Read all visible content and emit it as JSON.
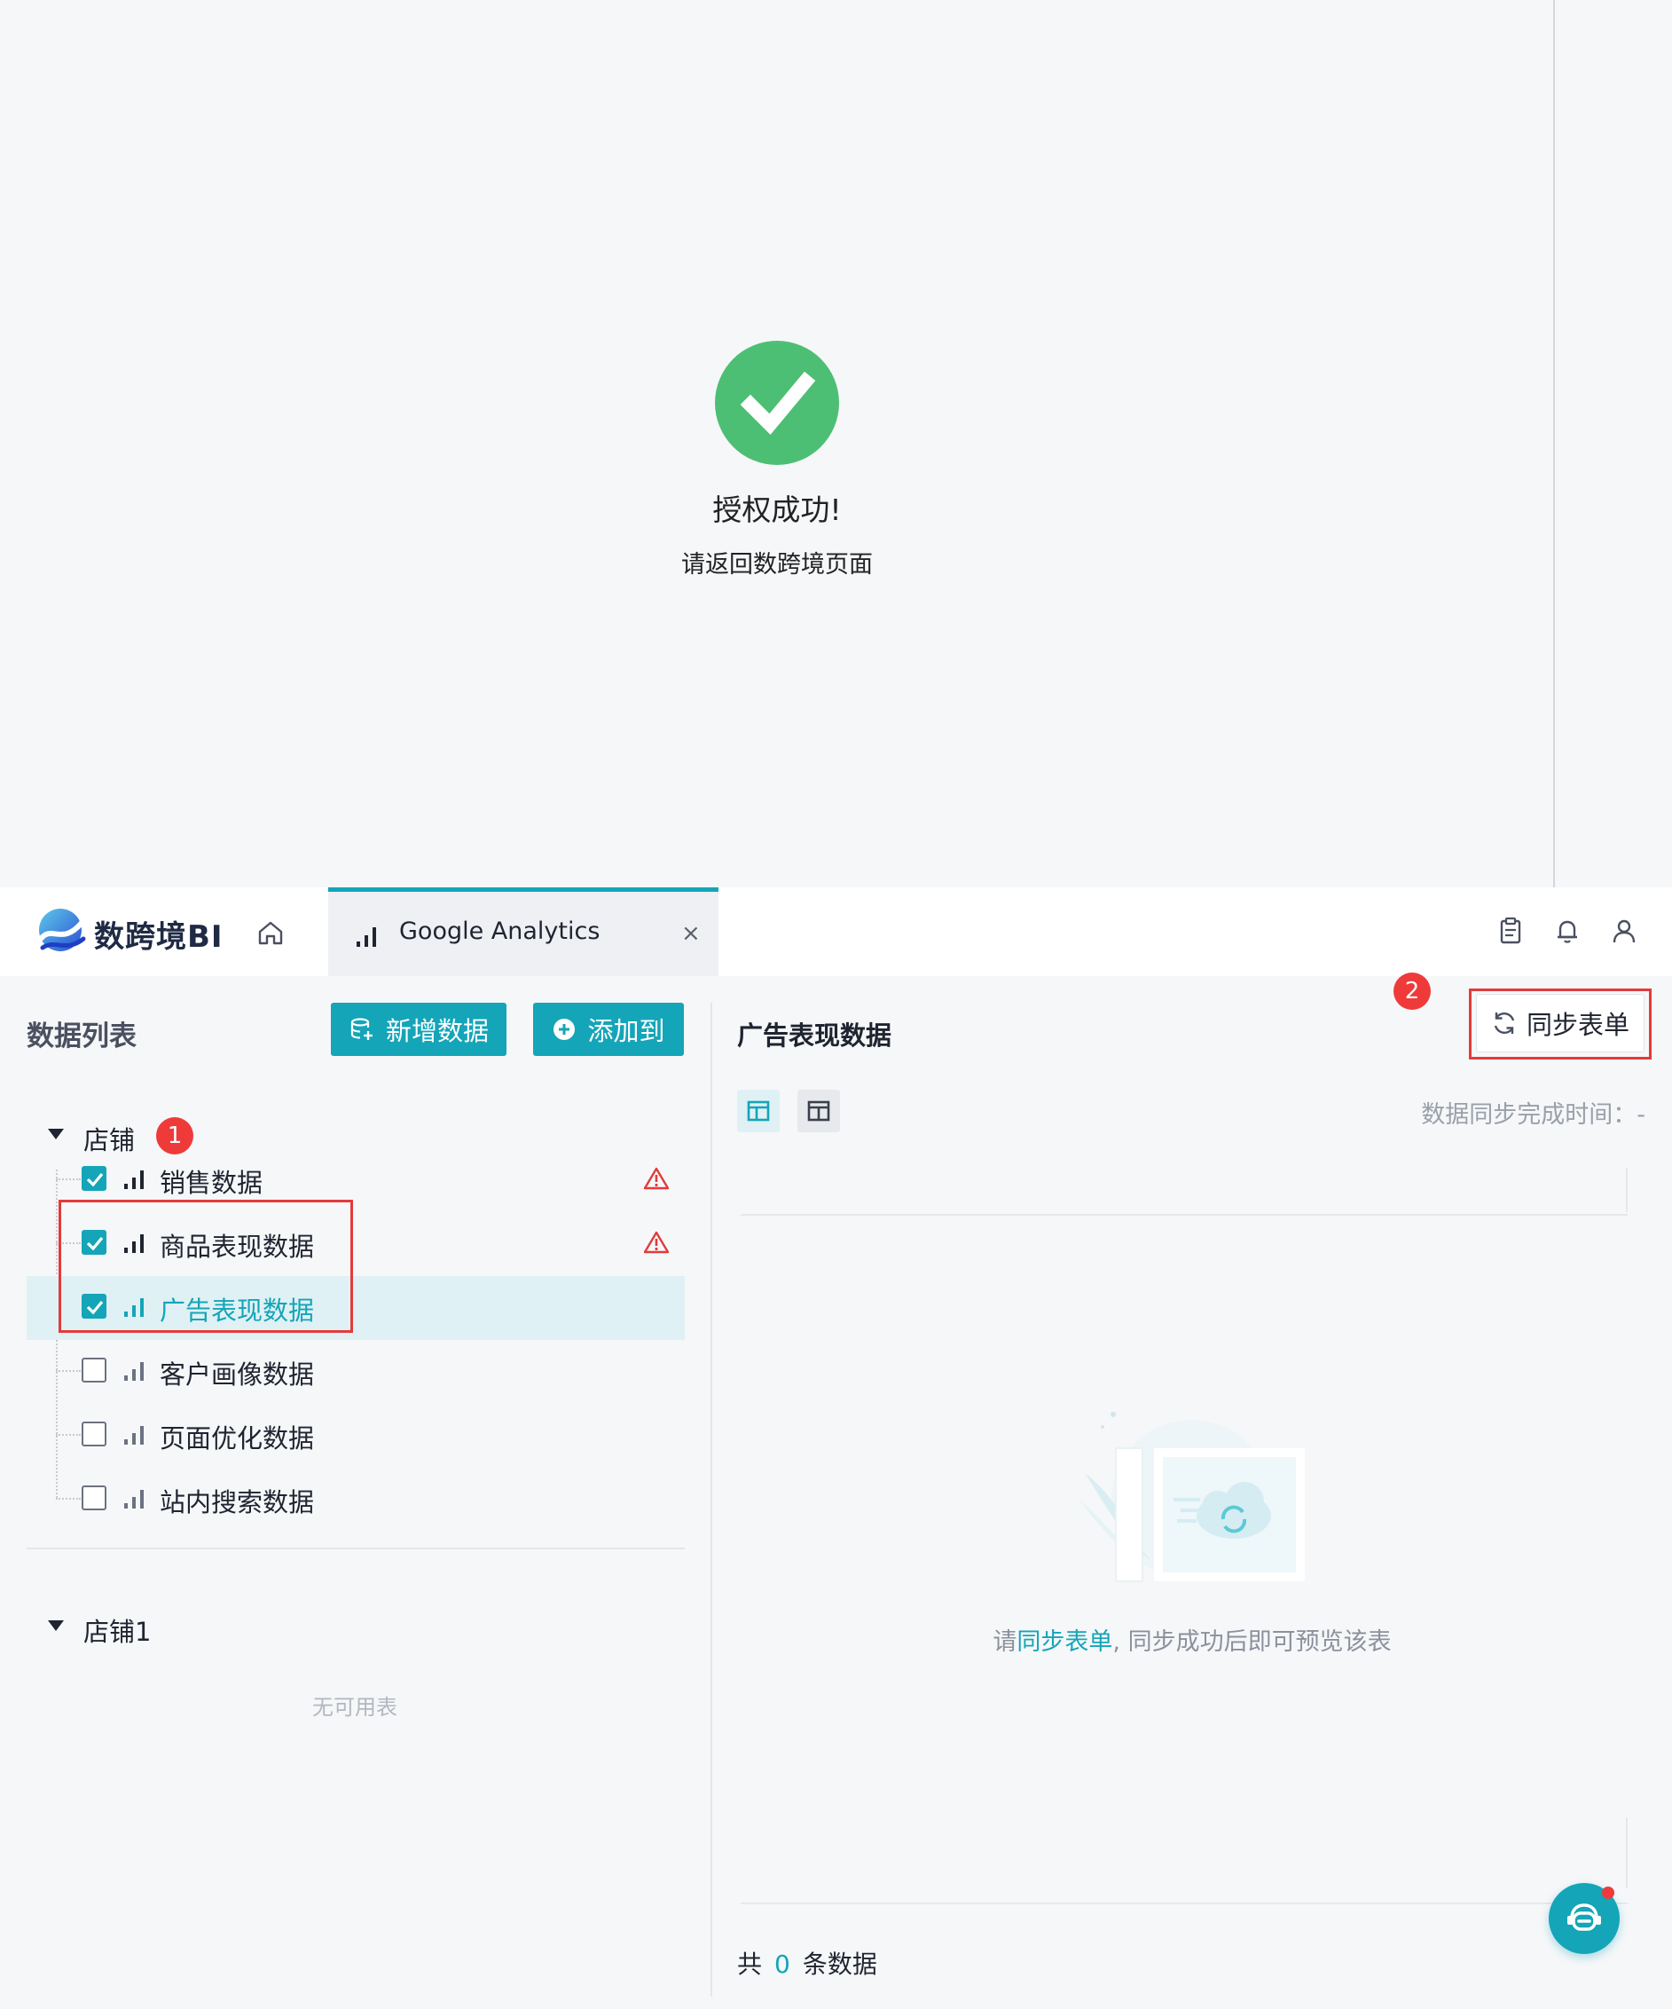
{
  "auth": {
    "title": "授权成功!",
    "subtitle": "请返回数跨境页面",
    "icon": "check-circle-icon",
    "accent": "#4dbf74"
  },
  "header": {
    "brand": "数跨境BI",
    "tab": {
      "label": "Google Analytics",
      "close": "×"
    },
    "icons": [
      "home-icon",
      "clipboard-icon",
      "bell-icon",
      "user-icon"
    ]
  },
  "left": {
    "title": "数据列表",
    "new_data_label": "新增数据",
    "add_to_label": "添加到",
    "groups": [
      {
        "label": "店铺",
        "badge": "1",
        "items": [
          {
            "label": "销售数据",
            "checked": true,
            "warning": true
          },
          {
            "label": "商品表现数据",
            "checked": true,
            "warning": true
          },
          {
            "label": "广告表现数据",
            "checked": true,
            "warning": false,
            "active": true
          },
          {
            "label": "客户画像数据",
            "checked": false,
            "warning": false
          },
          {
            "label": "页面优化数据",
            "checked": false,
            "warning": false
          },
          {
            "label": "站内搜索数据",
            "checked": false,
            "warning": false
          }
        ]
      },
      {
        "label": "店铺1",
        "empty_text": "无可用表"
      }
    ]
  },
  "right": {
    "title": "广告表现数据",
    "sync_label": "同步表单",
    "sync_badge": "2",
    "sync_time_label": "数据同步完成时间：-",
    "hint_prefix": "请",
    "hint_link": "同步表单",
    "hint_suffix": ", 同步成功后即可预览该表",
    "count_prefix": "共",
    "count_value": "0",
    "count_suffix": "条数据"
  },
  "colors": {
    "primary": "#14a5b8",
    "warning": "#e23b3b",
    "badge": "#ef3a3a",
    "active_row": "#dff1f4"
  }
}
